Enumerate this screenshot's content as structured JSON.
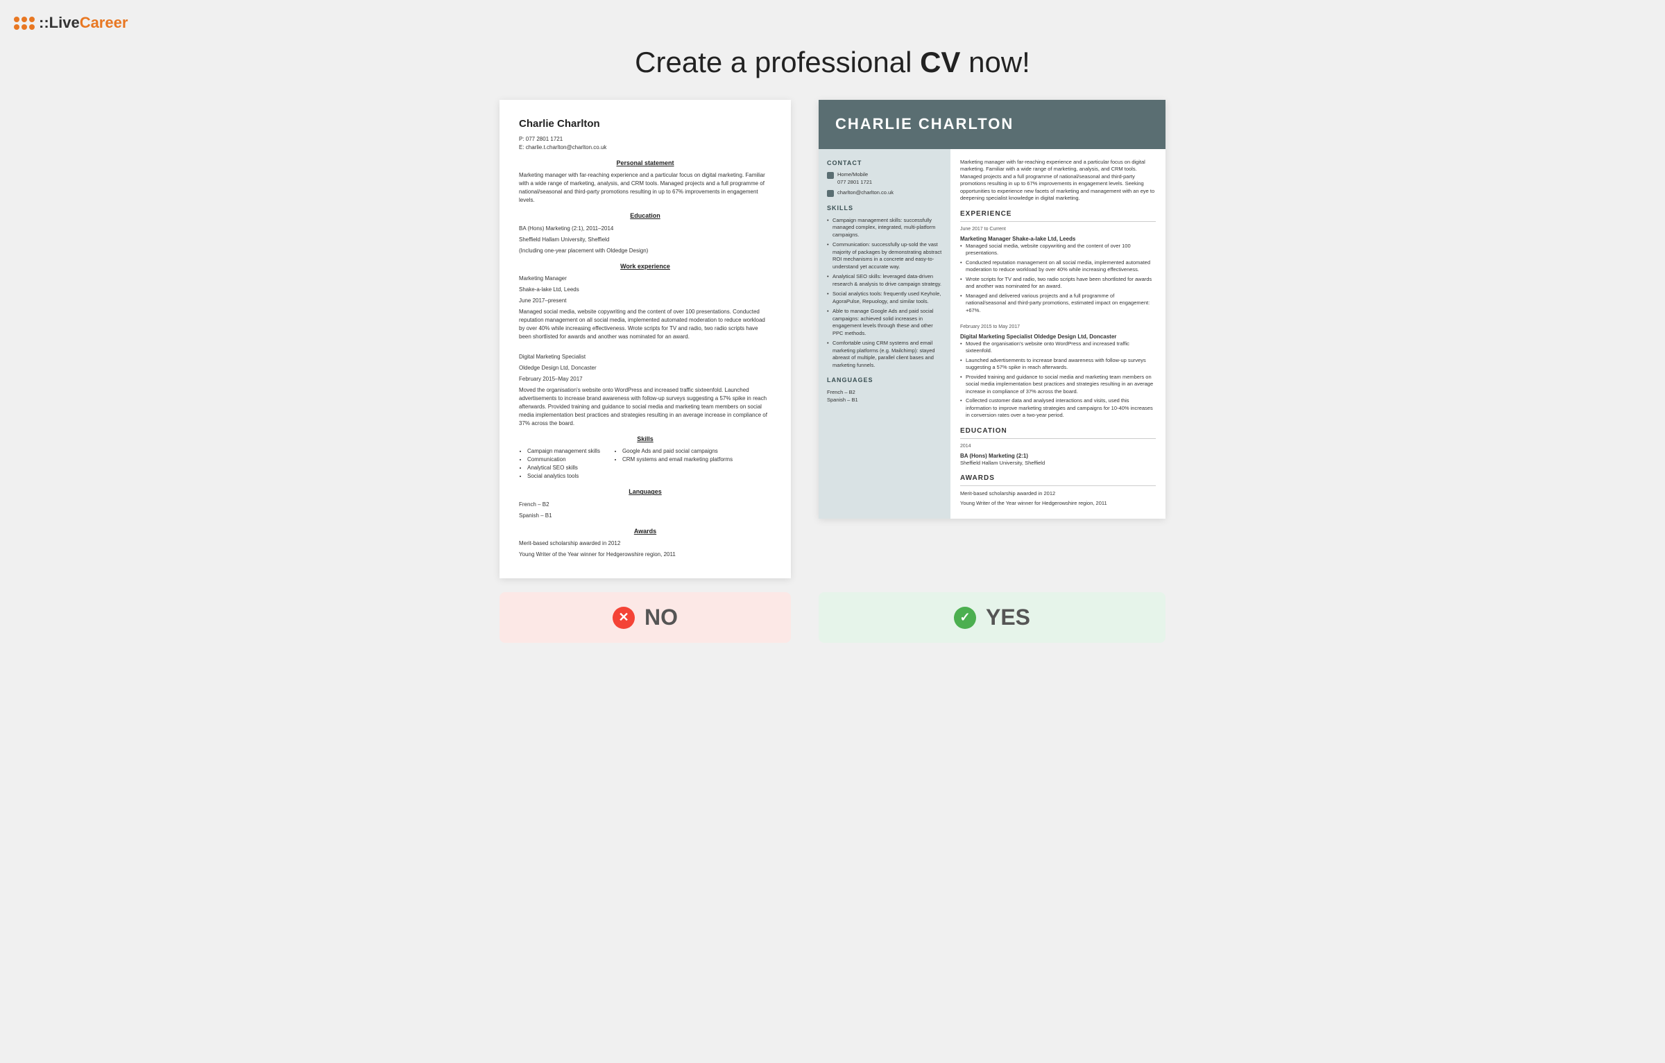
{
  "logo": {
    "text_live": "::Live",
    "text_career": "Career",
    "aria": "LiveCareer logo"
  },
  "headline": {
    "prefix": "Create a professional ",
    "bold": "CV",
    "suffix": " now!"
  },
  "bad_cv": {
    "name": "Charlie Charlton",
    "phone": "P: 077 2801 1721",
    "email": "E: charlie.t.charlton@charlton.co.uk",
    "personal_statement_title": "Personal statement",
    "personal_statement": "Marketing manager with far-reaching experience and a particular focus on digital marketing. Familiar with a wide range of marketing, analysis, and CRM tools. Managed projects and a full programme of national/seasonal and third-party promotions resulting in up to 67% improvements in engagement levels.",
    "education_title": "Education",
    "education_degree": "BA (Hons) Marketing (2:1), 2011–2014",
    "education_school": "Sheffield Hallam University, Sheffield",
    "education_note": "(Including one-year placement with Oldedge Design)",
    "work_title": "Work experience",
    "job1_title": "Marketing Manager",
    "job1_company": "Shake-a-lake Ltd, Leeds",
    "job1_dates": "June 2017–present",
    "job1_desc": "Managed social media, website copywriting and the content of over 100 presentations. Conducted reputation management on all social media, implemented automated moderation to reduce workload by over 40% while increasing effectiveness. Wrote scripts for TV and radio, two radio scripts have been shortlisted for awards and another was nominated for an award.",
    "job2_title": "Digital Marketing Specialist",
    "job2_company": "Oldedge Design Ltd, Doncaster",
    "job2_dates": "February 2015–May 2017",
    "job2_desc": "Moved the organisation's website onto WordPress and increased traffic sixteenfold. Launched advertisements to increase brand awareness with follow-up surveys suggesting a 57% spike in reach afterwards. Provided training and guidance to social media and marketing team members on social media implementation best practices and strategies resulting in an average increase in compliance of 37% across the board.",
    "skills_title": "Skills",
    "skills_left": [
      "Campaign management skills",
      "Communication",
      "Analytical SEO skills",
      "Social analytics tools"
    ],
    "skills_right": [
      "Google Ads and paid social campaigns",
      "CRM systems and email marketing platforms"
    ],
    "languages_title": "Languages",
    "lang1": "French – B2",
    "lang2": "Spanish – B1",
    "awards_title": "Awards",
    "award1": "Merit-based scholarship awarded in 2012",
    "award2": "Young Writer of the Year winner for Hedgerowshire region, 2011"
  },
  "good_cv": {
    "name": "CHARLIE CHARLTON",
    "contact_title": "CONTACT",
    "contact_phone_label": "Home/Mobile",
    "contact_phone": "077 2801 1721",
    "contact_email": "charlton@charlton.co.uk",
    "skills_title": "SKILLS",
    "skills": [
      "Campaign management skills: successfully managed complex, integrated, multi-platform campaigns.",
      "Communication: successfully up-sold the vast majority of packages by demonstrating abstract ROI mechanisms in a concrete and easy-to-understand yet accurate way.",
      "Analytical SEO skills: leveraged data-driven research & analysis to drive campaign strategy.",
      "Social analytics tools: frequently used Keyhole, AgoraPulse, Repuology, and similar tools.",
      "Able to manage Google Ads and paid social campaigns: achieved solid increases in engagement levels through these and other PPC methods.",
      "Comfortable using CRM systems and email marketing platforms (e.g. Mailchimp): stayed abreast of multiple, parallel client bases and marketing funnels."
    ],
    "languages_title": "LANGUAGES",
    "lang1": "French – B2",
    "lang2": "Spanish – B1",
    "personal_summary": "Marketing manager with far-reaching experience and a particular focus on digital marketing. Familiar with a wide range of marketing, analysis, and CRM tools. Managed projects and a full programme of national/seasonal and third-party promotions resulting in up to 67% improvements in engagement levels. Seeking opportunities to experience new facets of marketing and management with an eye to deepening specialist knowledge in digital marketing.",
    "experience_title": "EXPERIENCE",
    "job1_dates": "June 2017 to Current",
    "job1_title": "Marketing Manager Shake-a-lake Ltd, Leeds",
    "job1_bullets": [
      "Managed social media, website copywriting and the content of over 100 presentations.",
      "Conducted reputation management on all social media, implemented automated moderation to reduce workload by over 40% while increasing effectiveness.",
      "Wrote scripts for TV and radio, two radio scripts have been shortlisted for awards and another was nominated for an award.",
      "Managed and delivered various projects and a full programme of national/seasonal and third-party promotions, estimated impact on engagement: +67%."
    ],
    "job2_dates": "February 2015 to May 2017",
    "job2_title": "Digital Marketing Specialist Oldedge Design Ltd, Doncaster",
    "job2_bullets": [
      "Moved the organisation's website onto WordPress and increased traffic sixteenfold.",
      "Launched advertisements to increase brand awareness with follow-up surveys suggesting a 57% spike in reach afterwards.",
      "Provided training and guidance to social media and marketing team members on social media implementation best practices and strategies resulting in an average increase in compliance of 37% across the board.",
      "Collected customer data and analysed interactions and visits, used this information to improve marketing strategies and campaigns for 10-40% increases in conversion rates over a two-year period."
    ],
    "education_title": "EDUCATION",
    "edu_year": "2014",
    "edu_degree": "BA (Hons) Marketing (2:1)",
    "edu_school": "Sheffield Hallam University, Sheffield",
    "awards_title": "AWARDS",
    "award1": "Merit-based scholarship awarded in 2012",
    "award2": "Young Writer of the Year winner for Hedgerowshire region, 2011"
  },
  "buttons": {
    "no_label": "NO",
    "yes_label": "YES"
  }
}
